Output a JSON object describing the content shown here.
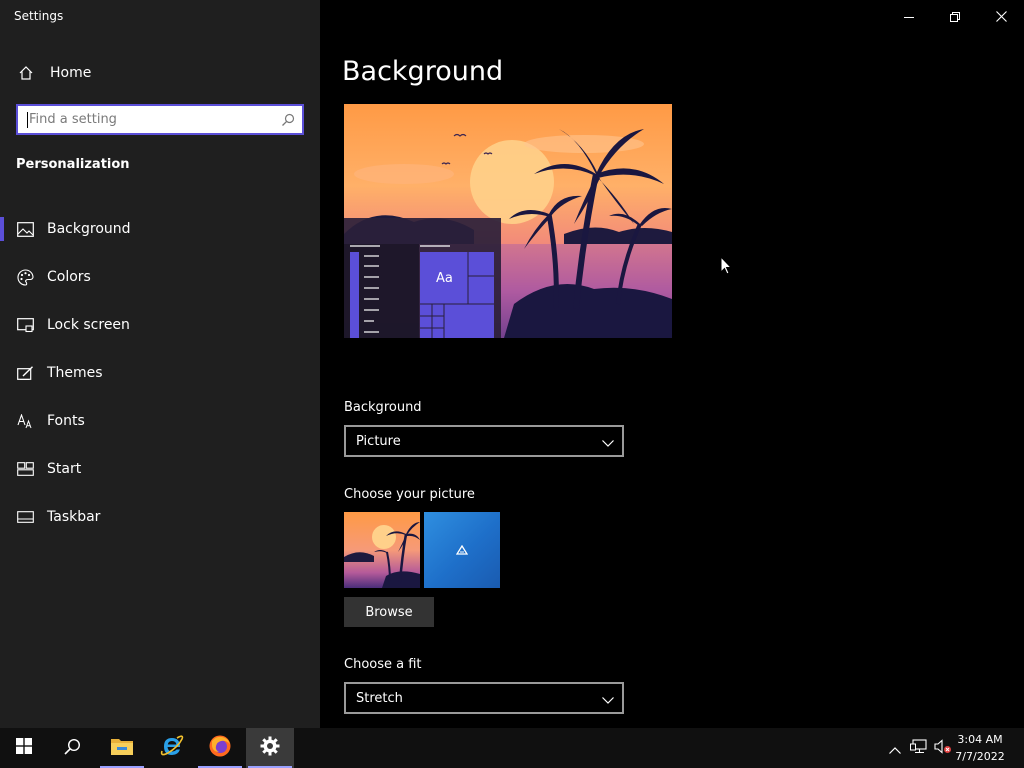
{
  "window": {
    "title": "Settings",
    "controls": [
      "minimize-icon",
      "restore-icon",
      "close-icon"
    ]
  },
  "sidebar": {
    "home_label": "Home",
    "search_placeholder": "Find a setting",
    "section_title": "Personalization",
    "items": [
      {
        "label": "Background",
        "icon": "picture-icon",
        "active": true
      },
      {
        "label": "Colors",
        "icon": "palette-icon",
        "active": false
      },
      {
        "label": "Lock screen",
        "icon": "lock-screen-icon",
        "active": false
      },
      {
        "label": "Themes",
        "icon": "themes-icon",
        "active": false
      },
      {
        "label": "Fonts",
        "icon": "fonts-icon",
        "active": false
      },
      {
        "label": "Start",
        "icon": "start-icon",
        "active": false
      },
      {
        "label": "Taskbar",
        "icon": "taskbar-icon",
        "active": false
      }
    ]
  },
  "main": {
    "page_title": "Background",
    "preview": {
      "sample_text": "Aa"
    },
    "background": {
      "label": "Background",
      "value": "Picture"
    },
    "choose_picture": {
      "label": "Choose your picture",
      "browse_label": "Browse"
    },
    "fit": {
      "label": "Choose a fit",
      "value": "Stretch"
    }
  },
  "colors": {
    "accent": "#5b4fd8",
    "sidebar_bg": "#1f1f1f",
    "main_bg": "#000000",
    "taskbar_bg": "#101010"
  },
  "taskbar": {
    "pinned": [
      "windows-start-icon",
      "search-icon",
      "file-explorer-icon",
      "internet-explorer-icon",
      "firefox-icon",
      "settings-gear-icon"
    ],
    "tray": [
      "chevron-up-icon",
      "network-icon",
      "volume-muted-icon"
    ],
    "time": "3:04 AM",
    "date": "7/7/2022"
  }
}
